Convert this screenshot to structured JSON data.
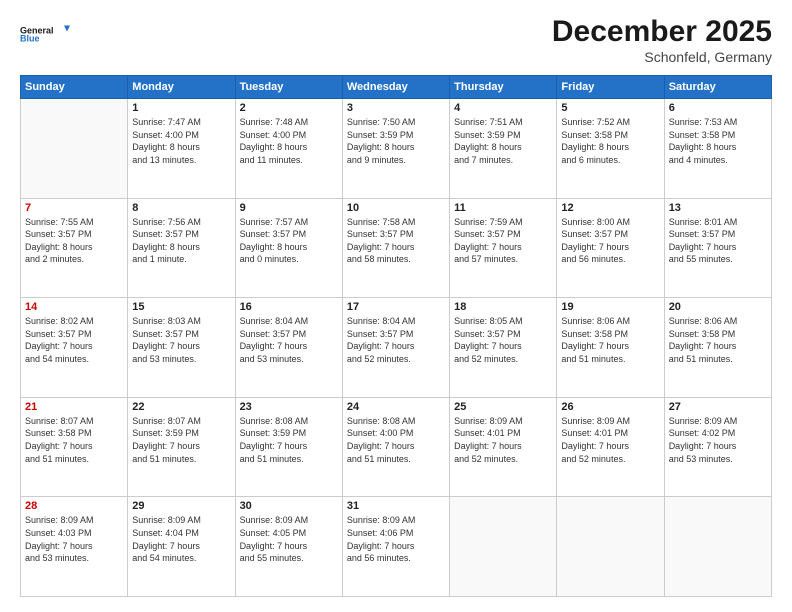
{
  "header": {
    "logo_line1": "General",
    "logo_line2": "Blue",
    "month": "December 2025",
    "location": "Schonfeld, Germany"
  },
  "weekdays": [
    "Sunday",
    "Monday",
    "Tuesday",
    "Wednesday",
    "Thursday",
    "Friday",
    "Saturday"
  ],
  "weeks": [
    [
      {
        "day": "",
        "info": ""
      },
      {
        "day": "1",
        "info": "Sunrise: 7:47 AM\nSunset: 4:00 PM\nDaylight: 8 hours\nand 13 minutes."
      },
      {
        "day": "2",
        "info": "Sunrise: 7:48 AM\nSunset: 4:00 PM\nDaylight: 8 hours\nand 11 minutes."
      },
      {
        "day": "3",
        "info": "Sunrise: 7:50 AM\nSunset: 3:59 PM\nDaylight: 8 hours\nand 9 minutes."
      },
      {
        "day": "4",
        "info": "Sunrise: 7:51 AM\nSunset: 3:59 PM\nDaylight: 8 hours\nand 7 minutes."
      },
      {
        "day": "5",
        "info": "Sunrise: 7:52 AM\nSunset: 3:58 PM\nDaylight: 8 hours\nand 6 minutes."
      },
      {
        "day": "6",
        "info": "Sunrise: 7:53 AM\nSunset: 3:58 PM\nDaylight: 8 hours\nand 4 minutes."
      }
    ],
    [
      {
        "day": "7",
        "info": "Sunrise: 7:55 AM\nSunset: 3:57 PM\nDaylight: 8 hours\nand 2 minutes."
      },
      {
        "day": "8",
        "info": "Sunrise: 7:56 AM\nSunset: 3:57 PM\nDaylight: 8 hours\nand 1 minute."
      },
      {
        "day": "9",
        "info": "Sunrise: 7:57 AM\nSunset: 3:57 PM\nDaylight: 8 hours\nand 0 minutes."
      },
      {
        "day": "10",
        "info": "Sunrise: 7:58 AM\nSunset: 3:57 PM\nDaylight: 7 hours\nand 58 minutes."
      },
      {
        "day": "11",
        "info": "Sunrise: 7:59 AM\nSunset: 3:57 PM\nDaylight: 7 hours\nand 57 minutes."
      },
      {
        "day": "12",
        "info": "Sunrise: 8:00 AM\nSunset: 3:57 PM\nDaylight: 7 hours\nand 56 minutes."
      },
      {
        "day": "13",
        "info": "Sunrise: 8:01 AM\nSunset: 3:57 PM\nDaylight: 7 hours\nand 55 minutes."
      }
    ],
    [
      {
        "day": "14",
        "info": "Sunrise: 8:02 AM\nSunset: 3:57 PM\nDaylight: 7 hours\nand 54 minutes."
      },
      {
        "day": "15",
        "info": "Sunrise: 8:03 AM\nSunset: 3:57 PM\nDaylight: 7 hours\nand 53 minutes."
      },
      {
        "day": "16",
        "info": "Sunrise: 8:04 AM\nSunset: 3:57 PM\nDaylight: 7 hours\nand 53 minutes."
      },
      {
        "day": "17",
        "info": "Sunrise: 8:04 AM\nSunset: 3:57 PM\nDaylight: 7 hours\nand 52 minutes."
      },
      {
        "day": "18",
        "info": "Sunrise: 8:05 AM\nSunset: 3:57 PM\nDaylight: 7 hours\nand 52 minutes."
      },
      {
        "day": "19",
        "info": "Sunrise: 8:06 AM\nSunset: 3:58 PM\nDaylight: 7 hours\nand 51 minutes."
      },
      {
        "day": "20",
        "info": "Sunrise: 8:06 AM\nSunset: 3:58 PM\nDaylight: 7 hours\nand 51 minutes."
      }
    ],
    [
      {
        "day": "21",
        "info": "Sunrise: 8:07 AM\nSunset: 3:58 PM\nDaylight: 7 hours\nand 51 minutes."
      },
      {
        "day": "22",
        "info": "Sunrise: 8:07 AM\nSunset: 3:59 PM\nDaylight: 7 hours\nand 51 minutes."
      },
      {
        "day": "23",
        "info": "Sunrise: 8:08 AM\nSunset: 3:59 PM\nDaylight: 7 hours\nand 51 minutes."
      },
      {
        "day": "24",
        "info": "Sunrise: 8:08 AM\nSunset: 4:00 PM\nDaylight: 7 hours\nand 51 minutes."
      },
      {
        "day": "25",
        "info": "Sunrise: 8:09 AM\nSunset: 4:01 PM\nDaylight: 7 hours\nand 52 minutes."
      },
      {
        "day": "26",
        "info": "Sunrise: 8:09 AM\nSunset: 4:01 PM\nDaylight: 7 hours\nand 52 minutes."
      },
      {
        "day": "27",
        "info": "Sunrise: 8:09 AM\nSunset: 4:02 PM\nDaylight: 7 hours\nand 53 minutes."
      }
    ],
    [
      {
        "day": "28",
        "info": "Sunrise: 8:09 AM\nSunset: 4:03 PM\nDaylight: 7 hours\nand 53 minutes."
      },
      {
        "day": "29",
        "info": "Sunrise: 8:09 AM\nSunset: 4:04 PM\nDaylight: 7 hours\nand 54 minutes."
      },
      {
        "day": "30",
        "info": "Sunrise: 8:09 AM\nSunset: 4:05 PM\nDaylight: 7 hours\nand 55 minutes."
      },
      {
        "day": "31",
        "info": "Sunrise: 8:09 AM\nSunset: 4:06 PM\nDaylight: 7 hours\nand 56 minutes."
      },
      {
        "day": "",
        "info": ""
      },
      {
        "day": "",
        "info": ""
      },
      {
        "day": "",
        "info": ""
      }
    ]
  ]
}
